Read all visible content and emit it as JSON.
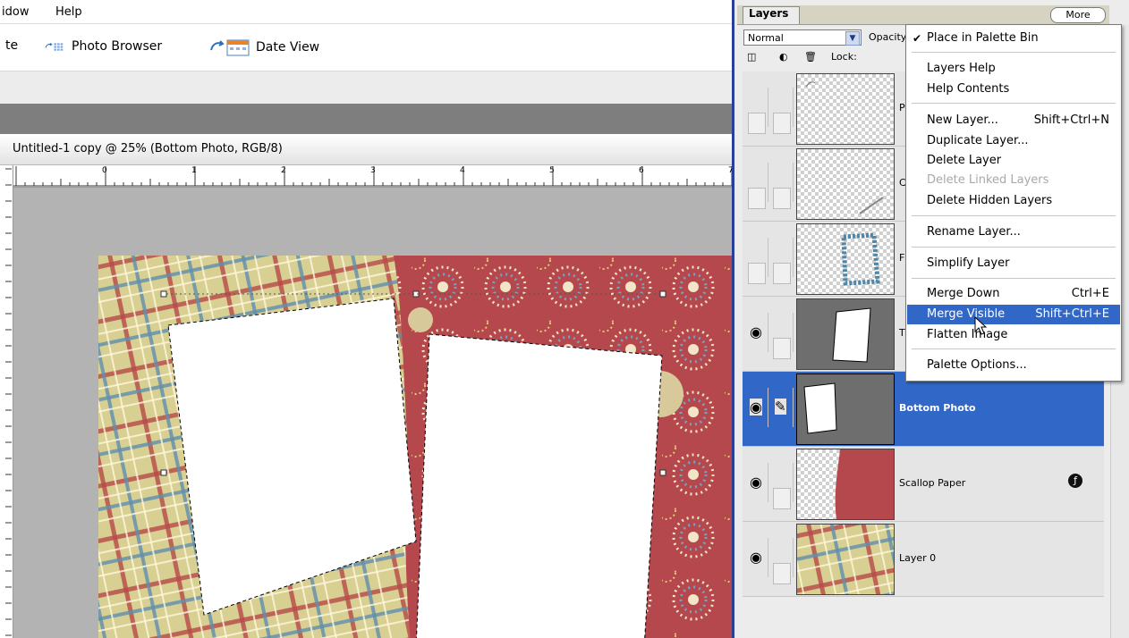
{
  "menubar": {
    "items": [
      "idow",
      "Help"
    ]
  },
  "shortcuts": {
    "create_partial": "te",
    "photo_browser": "Photo Browser",
    "date_view": "Date View"
  },
  "document": {
    "title": "Untitled-1 copy @ 25% (Bottom Photo, RGB/8)"
  },
  "ruler": {
    "h_numbers": [
      "0",
      "1",
      "2",
      "3",
      "4",
      "5",
      "6",
      "7"
    ]
  },
  "palette": {
    "tab_label": "Layers",
    "more_label": "More",
    "blend_mode": "Normal",
    "opacity_label": "Opacity",
    "lock_label": "Lock:",
    "layers": [
      {
        "name": "P",
        "visible": false,
        "selected": false,
        "thumb": "checker-stroke"
      },
      {
        "name": "C",
        "visible": false,
        "selected": false,
        "thumb": "checker-line"
      },
      {
        "name": "F",
        "visible": false,
        "selected": false,
        "thumb": "checker-frame"
      },
      {
        "name": "T",
        "visible": true,
        "selected": false,
        "thumb": "gray-photo"
      },
      {
        "name": "Bottom Photo",
        "visible": true,
        "selected": true,
        "thumb": "gray-photo",
        "brush": true
      },
      {
        "name": "Scallop Paper",
        "visible": true,
        "selected": false,
        "thumb": "checker-red",
        "fx": true
      },
      {
        "name": "Layer 0",
        "visible": true,
        "selected": false,
        "thumb": "plaid"
      }
    ]
  },
  "menu": {
    "items": [
      {
        "label": "Place in Palette Bin",
        "checked": true
      },
      {
        "label": "Layers Help"
      },
      {
        "label": "Help Contents"
      },
      {
        "label": "New Layer...",
        "shortcut": "Shift+Ctrl+N"
      },
      {
        "label": "Duplicate Layer..."
      },
      {
        "label": "Delete Layer"
      },
      {
        "label": "Delete Linked Layers",
        "disabled": true
      },
      {
        "label": "Delete Hidden Layers"
      },
      {
        "label": "Rename Layer..."
      },
      {
        "label": "Simplify Layer"
      },
      {
        "label": "Merge Down",
        "shortcut": "Ctrl+E"
      },
      {
        "label": "Merge Visible",
        "shortcut": "Shift+Ctrl+E",
        "highlighted": true
      },
      {
        "label": "Flatten Image"
      },
      {
        "label": "Palette Options..."
      }
    ]
  },
  "colors": {
    "selection": "#3168c8",
    "palette_border": "#2a3f9b",
    "paper_red": "#b5484c",
    "paper_plaid": "#d8d095"
  }
}
